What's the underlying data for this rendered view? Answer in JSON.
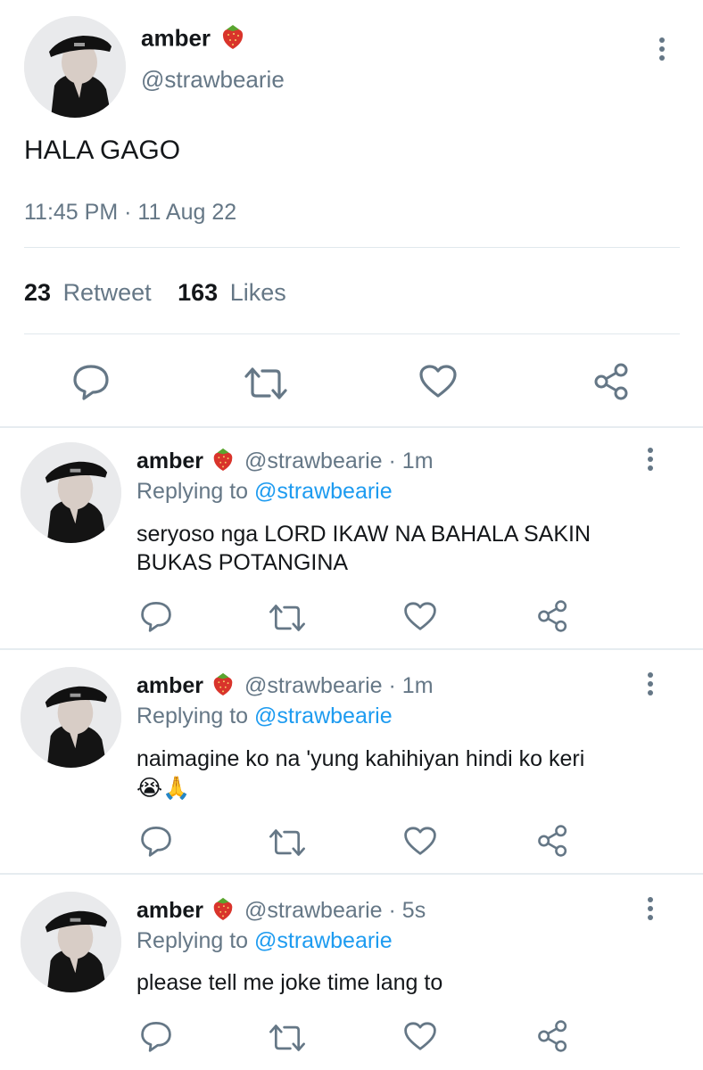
{
  "main_tweet": {
    "display_name": "amber",
    "name_emoji": "strawberry",
    "handle": "@strawbearie",
    "text": "HALA GAGO",
    "time": "11:45 PM",
    "separator": "·",
    "date": "11 Aug 22",
    "retweet_count": "23",
    "retweet_label": "Retweet",
    "likes_count": "163",
    "likes_label": "Likes"
  },
  "replies": [
    {
      "display_name": "amber",
      "handle": "@strawbearie",
      "dot": "·",
      "time": "1m",
      "replying_label": "Replying to",
      "replying_handle": "@strawbearie",
      "text_line1": "seryoso nga LORD IKAW NA BAHALA SAKIN",
      "text_line2": "BUKAS POTANGINA"
    },
    {
      "display_name": "amber",
      "handle": "@strawbearie",
      "dot": "·",
      "time": "1m",
      "replying_label": "Replying to",
      "replying_handle": "@strawbearie",
      "text_line1": "naimagine ko na 'yung kahihiyan hindi ko keri",
      "text_line2": "😭🙏"
    },
    {
      "display_name": "amber",
      "handle": "@strawbearie",
      "dot": "·",
      "time": "5s",
      "replying_label": "Replying to",
      "replying_handle": "@strawbearie",
      "text_line1": "please tell me joke time lang to",
      "text_line2": ""
    }
  ],
  "icons": {
    "reply": "reply-icon",
    "retweet": "retweet-icon",
    "like": "heart-icon",
    "share": "share-icon",
    "more": "more-vertical-icon"
  },
  "colors": {
    "text": "#14171a",
    "muted": "#657786",
    "link": "#1d9bf0",
    "divider": "#e1e8ed"
  }
}
